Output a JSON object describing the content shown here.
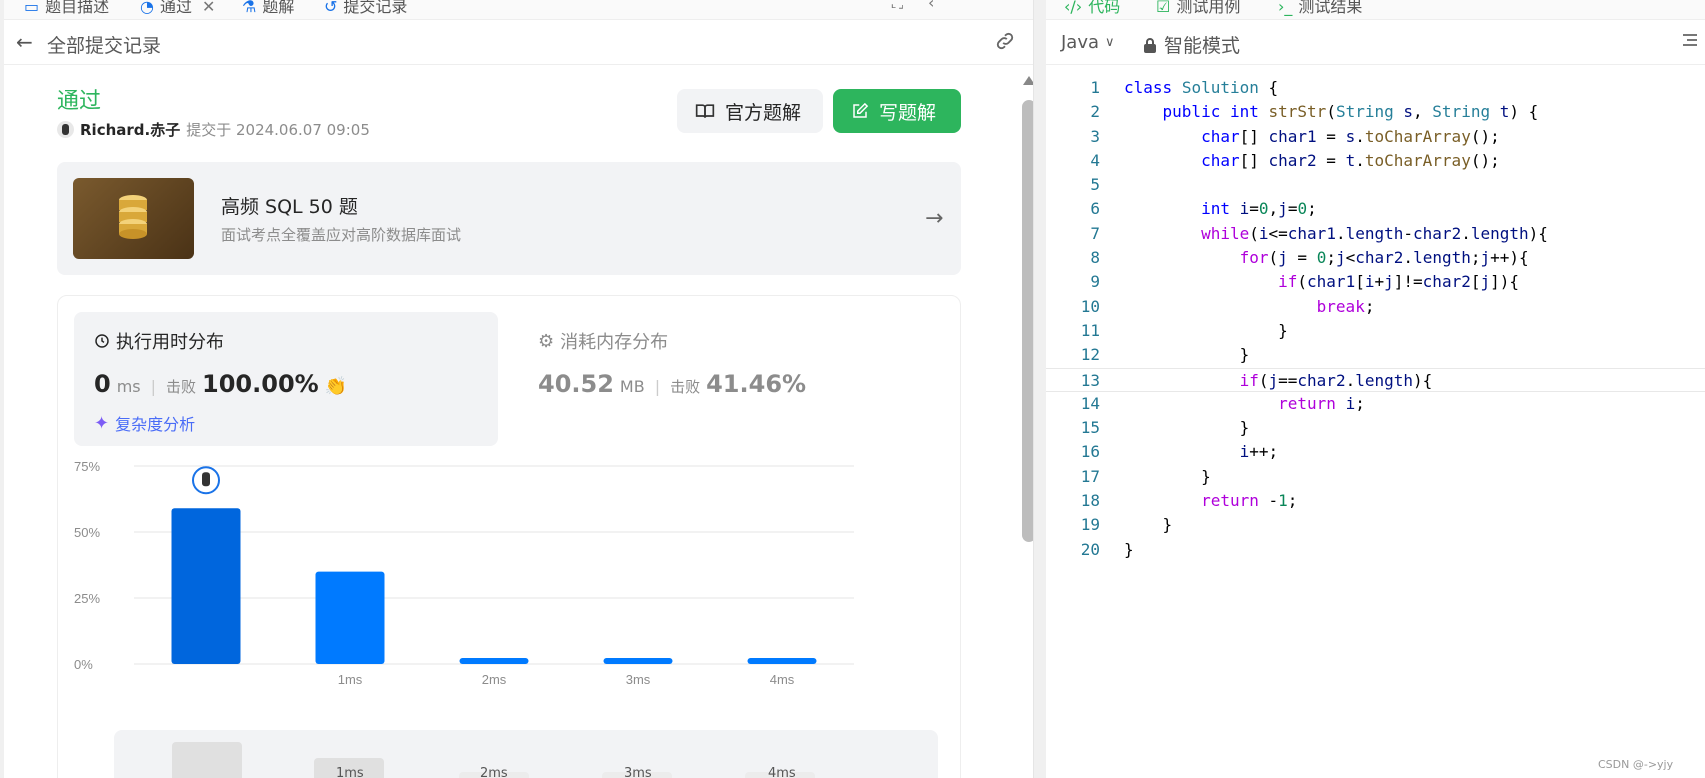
{
  "tabs": [
    {
      "label": "题目描述",
      "icon": "doc-icon"
    },
    {
      "label": "通过",
      "icon": "spinner-icon",
      "closable": true
    },
    {
      "label": "题解",
      "icon": "flask-icon"
    },
    {
      "label": "提交记录",
      "icon": "history-icon"
    }
  ],
  "header": {
    "back_label": "全部提交记录"
  },
  "submission": {
    "status": "通过",
    "username": "Richard.赤子",
    "submitted_text": "提交于 2024.06.07 09:05"
  },
  "buttons": {
    "official_solution": "官方题解",
    "write_solution": "写题解"
  },
  "promo": {
    "title": "高频 SQL 50 题",
    "description": "面试考点全覆盖应对高阶数据库面试"
  },
  "runtime": {
    "title": "执行用时分布",
    "value": "0",
    "unit": "ms",
    "beat_label": "击败",
    "beat_value": "100.00%",
    "complexity_label": "复杂度分析"
  },
  "memory": {
    "title": "消耗内存分布",
    "value": "40.52",
    "unit": "MB",
    "beat_label": "击败",
    "beat_value": "41.46%"
  },
  "chart_data": {
    "type": "bar",
    "categories": [
      "",
      "1ms",
      "2ms",
      "3ms",
      "4ms"
    ],
    "values": [
      59,
      35,
      1.5,
      1.5,
      1.5
    ],
    "ylim": [
      0,
      75
    ],
    "yticks": [
      "0%",
      "25%",
      "50%",
      "75%"
    ],
    "ytick_values": [
      0,
      25,
      50,
      75
    ],
    "highlight_index": 0,
    "colors": {
      "bar": "#007aff",
      "highlight": "#0066dd",
      "grid": "#e5e5e5"
    }
  },
  "range_strip": {
    "labels": [
      "1ms",
      "2ms",
      "3ms",
      "4ms"
    ]
  },
  "editor": {
    "tabs": [
      {
        "label": "代码",
        "icon": "code-icon"
      },
      {
        "label": "测试用例",
        "icon": "checkbox-icon"
      },
      {
        "label": "测试结果",
        "icon": "terminal-icon"
      }
    ],
    "language": "Java",
    "mode": "智能模式",
    "active_line": 13,
    "lines": [
      "class Solution {",
      "    public int strStr(String s, String t) {",
      "        char[] char1 = s.toCharArray();",
      "        char[] char2 = t.toCharArray();",
      "",
      "        int i=0,j=0;",
      "        while(i<=char1.length-char2.length){",
      "            for(j = 0;j<char2.length;j++){",
      "                if(char1[i+j]!=char2[j]){",
      "                    break;",
      "                }",
      "            }",
      "            if(j==char2.length){",
      "                return i;",
      "            }",
      "            i++;",
      "        }",
      "        return -1;",
      "    }",
      "}"
    ]
  },
  "watermark": "CSDN @->yjy"
}
